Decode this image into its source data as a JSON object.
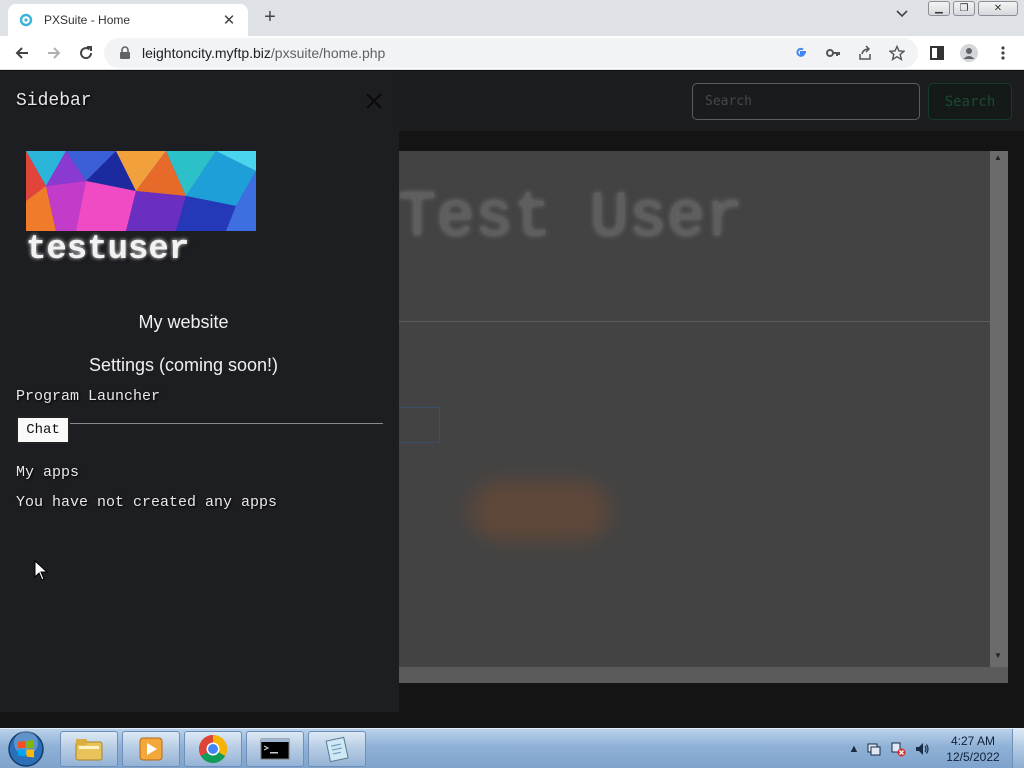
{
  "browser": {
    "tab_title": "PXSuite - Home",
    "url_host": "leightoncity.myftp.biz",
    "url_path": "/pxsuite/home.php"
  },
  "topnav": {
    "search_placeholder": "Search",
    "search_button": "Search"
  },
  "main": {
    "hero_name": "Test User"
  },
  "sidebar": {
    "title": "Sidebar",
    "username": "testuser",
    "links": [
      "My website",
      "Settings (coming soon!)"
    ],
    "program_launcher_label": "Program Launcher",
    "chat_button": "Chat",
    "my_apps_label": "My apps",
    "no_apps_message": "You have not created any apps"
  },
  "taskbar": {
    "time": "4:27 AM",
    "date": "12/5/2022"
  }
}
